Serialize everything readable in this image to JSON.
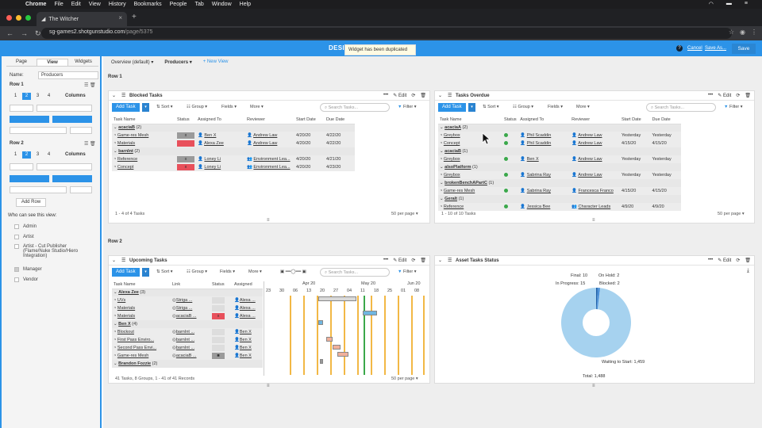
{
  "os_menu": {
    "app": "Chrome",
    "items": [
      "File",
      "Edit",
      "View",
      "History",
      "Bookmarks",
      "People",
      "Tab",
      "Window",
      "Help"
    ]
  },
  "browser": {
    "tab_title": "The Witcher",
    "url_host": "sg-games2.shotgunstudio.com",
    "url_path": "/page/5375"
  },
  "header": {
    "title": "DESI                              board",
    "help": "?",
    "cancel": "Cancel",
    "save_as": "Save As...",
    "save": "Save"
  },
  "toast": "Widget has been duplicated",
  "left_panel": {
    "tabs": [
      "Page",
      "View",
      "Widgets"
    ],
    "name_label": "Name:",
    "name_value": "Producers",
    "row1": "Row 1",
    "row2": "Row 2",
    "columns_label": "Columns",
    "col_options": [
      "1",
      "2",
      "3",
      "4"
    ],
    "add_row": "Add Row",
    "who_label": "Who can see this view:",
    "roles": [
      "Admin",
      "Artist",
      "Artist - Cut Publisher (Flame/Nuke Studio/Hiero Integration)",
      "Manager",
      "Vendor"
    ]
  },
  "view_tabs": {
    "overview": "Overview (default)",
    "producers": "Producers",
    "new_view": "+ New View"
  },
  "rows": {
    "row1": "Row 1",
    "row2": "Row 2"
  },
  "common": {
    "add_task": "Add Task",
    "sort": "Sort",
    "group": "Group",
    "fields": "Fields",
    "more": "More",
    "search": "Search Tasks...",
    "filter": "Filter",
    "edit": "Edit",
    "per_page": "50 per page"
  },
  "blocked": {
    "title": "Blocked Tasks",
    "headers": [
      "Task Name",
      "Status",
      "Assigned To",
      "Reviewer",
      "Start Date",
      "Due Date"
    ],
    "groups": [
      {
        "name": "acaciaB",
        "count": "(2)",
        "rows": [
          {
            "task": "Game-res Mesh",
            "status": "x",
            "assigned": "Ben X",
            "reviewer": "Andrew Law",
            "start": "4/20/20",
            "due": "4/22/20",
            "red": false
          },
          {
            "task": "Materials",
            "status": "",
            "assigned": "Alexa Zee",
            "reviewer": "Andrew Law",
            "start": "4/20/20",
            "due": "4/22/20",
            "red": true
          }
        ]
      },
      {
        "name": "barnInt",
        "count": "(2)",
        "rows": [
          {
            "task": "Reference",
            "status": "x",
            "assigned": "Loney Li",
            "reviewer": "Environment Lea...",
            "start": "4/20/20",
            "due": "4/21/20",
            "red": false
          },
          {
            "task": "Concept",
            "status": "x",
            "assigned": "Loney Li",
            "reviewer": "Environment Lea...",
            "start": "4/20/20",
            "due": "4/23/20",
            "red": true
          }
        ]
      }
    ],
    "footer": "1 - 4 of 4 Tasks"
  },
  "overdue": {
    "title": "Tasks Overdue",
    "headers": [
      "Task Name",
      "Status",
      "Assigned To",
      "Reviewer",
      "Start Date",
      "Due Date"
    ],
    "groups": [
      {
        "name": "acaciaA",
        "count": "(2)",
        "rows": [
          {
            "task": "Greybox",
            "assigned": "Phil Scaddin",
            "reviewer": "Andrew Law",
            "start": "Yesterday",
            "due": "Yesterday"
          },
          {
            "task": "Concept",
            "assigned": "Phil Scaddin",
            "reviewer": "Andrew Law",
            "start": "4/15/20",
            "due": "4/15/20"
          }
        ]
      },
      {
        "name": "acaciaB",
        "count": "(1)",
        "rows": [
          {
            "task": "Greybox",
            "assigned": "Ben X",
            "reviewer": "Andrew Law",
            "start": "Yesterday",
            "due": "Yesterday"
          }
        ]
      },
      {
        "name": "alsoPlatform",
        "count": "(1)",
        "rows": [
          {
            "task": "Greybox",
            "assigned": "Sabrina Ray",
            "reviewer": "Andrew Law",
            "start": "Yesterday",
            "due": "Yesterday"
          }
        ]
      },
      {
        "name": "brokenBenchAPartC",
        "count": "(1)",
        "rows": [
          {
            "task": "Game-res Mesh",
            "assigned": "Sabrina Ray",
            "reviewer": "Francesca Franco",
            "start": "4/15/20",
            "due": "4/15/20"
          }
        ]
      },
      {
        "name": "Geralt",
        "count": "(1)",
        "rows": [
          {
            "task": "Reference",
            "assigned": "Jessica Bee",
            "reviewer": "Character Leads",
            "start": "4/9/20",
            "due": "4/9/20"
          }
        ]
      }
    ],
    "footer": "1 - 10 of 10 Tasks"
  },
  "upcoming": {
    "title": "Upcoming Tasks",
    "headers": [
      "Task Name",
      "Link",
      "Status",
      "Assigned"
    ],
    "groups": [
      {
        "name": "Alexa Zee",
        "count": "(3)",
        "rows": [
          {
            "task": "UVs",
            "link": "Striga ...",
            "status": "",
            "assigned": "Alexa ..."
          },
          {
            "task": "Materials",
            "link": "Striga ...",
            "status": "",
            "assigned": "Alexa ..."
          },
          {
            "task": "Materials",
            "link": "acaciaB ...",
            "status": "x",
            "assigned": "Alexa ..."
          }
        ]
      },
      {
        "name": "Ben X",
        "count": "(4)",
        "rows": [
          {
            "task": "Blockout",
            "link": "barnInt ...",
            "status": "",
            "assigned": "Ben X"
          },
          {
            "task": "First Pass Enviro...",
            "link": "barnInt ...",
            "status": "",
            "assigned": "Ben X"
          },
          {
            "task": "Second Pass Envi...",
            "link": "barnInt ...",
            "status": "",
            "assigned": "Ben X"
          },
          {
            "task": "Game-res Mesh",
            "link": "acaciaB ...",
            "status": "■",
            "assigned": "Ben X"
          }
        ]
      },
      {
        "name": "Brandon Fozzie",
        "count": "(2)",
        "rows": []
      }
    ],
    "gantt_months": [
      "Apr 20",
      "May 20",
      "Jun 20"
    ],
    "gantt_days": [
      "23",
      "30",
      "06",
      "13",
      "20",
      "27",
      "04",
      "11",
      "18",
      "25",
      "01",
      "08"
    ],
    "footer": "41 Tasks, 8 Groups, 1 - 41 of 41 Records"
  },
  "asset_status": {
    "title": "Asset Tasks Status",
    "total": "Total: 1,488",
    "colors": {
      "waiting": "#a6d2ef",
      "in_progress": "#4a90d9",
      "final": "#1f5fa8",
      "on_hold": "#2b7bc4",
      "blocked": "#7fb8e6"
    },
    "chart_data": {
      "type": "pie",
      "labels": [
        "Final",
        "On Hold",
        "In Progress",
        "Blocked",
        "Waiting to Start"
      ],
      "values": [
        10,
        2,
        15,
        2,
        1459
      ],
      "label_text": {
        "final": "Final: 10",
        "on_hold": "On Hold: 2",
        "in_progress": "In Progress: 15",
        "blocked": "Blocked: 2",
        "waiting": "Waiting to Start: 1,459"
      }
    }
  }
}
